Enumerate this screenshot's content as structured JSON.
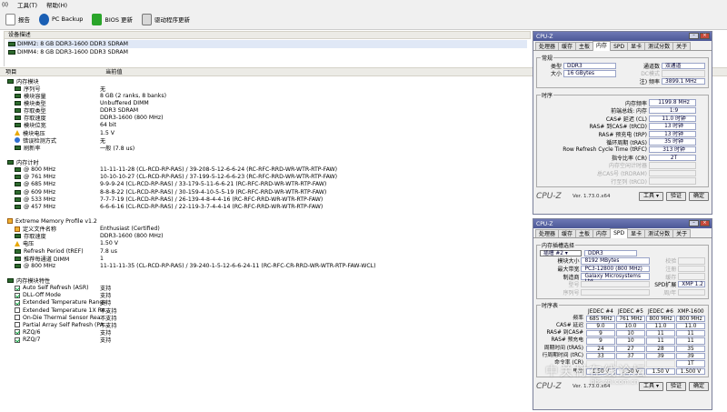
{
  "menu": [
    "(I)",
    "工具(T)",
    "帮助(H)"
  ],
  "toolbar": {
    "report": "报告",
    "pc_backup": "PC Backup",
    "bios_update": "BIOS 更新",
    "driver_update": "驱动程序更新"
  },
  "device_header": "设备描述",
  "devices": [
    "DIMM2: 8 GB DDR3-1600 DDR3 SDRAM",
    "DIMM4: 8 GB DDR3-1600 DDR3 SDRAM"
  ],
  "columns": {
    "field": "项目",
    "value": "当前值"
  },
  "sections": [
    {
      "title": "内存模块",
      "rows": [
        {
          "f": "序列号",
          "v": "无",
          "ic": "sq"
        },
        {
          "f": "模块容量",
          "v": "8 GB (2 ranks, 8 banks)",
          "ic": "sq"
        },
        {
          "f": "模块类型",
          "v": "Unbuffered DIMM",
          "ic": "sq"
        },
        {
          "f": "存取类型",
          "v": "DDR3 SDRAM",
          "ic": "sq"
        },
        {
          "f": "存取速度",
          "v": "DDR3-1600 (800 MHz)",
          "ic": "sq"
        },
        {
          "f": "模块位宽",
          "v": "64 bit",
          "ic": "sq"
        },
        {
          "f": "模块电压",
          "v": "1.5 V",
          "ic": "warn"
        },
        {
          "f": "错误检测方式",
          "v": "无",
          "ic": "info"
        },
        {
          "f": "刷新率",
          "v": "一般 (7.8 us)",
          "ic": "sq"
        }
      ]
    },
    {
      "title": "内存计时",
      "rows": [
        {
          "f": "@ 800 MHz",
          "v": "11-11-11-28  (CL-RCD-RP-RAS) / 39-208-5-12-6-6-24  (RC-RFC-RRD-WR-WTR-RTP-FAW)",
          "ic": "sq"
        },
        {
          "f": "@ 761 MHz",
          "v": "10-10-10-27  (CL-RCD-RP-RAS) / 37-199-5-12-6-6-23  (RC-RFC-RRD-WR-WTR-RTP-FAW)",
          "ic": "sq"
        },
        {
          "f": "@ 685 MHz",
          "v": "9-9-9-24  (CL-RCD-RP-RAS) / 33-179-5-11-6-6-21  (RC-RFC-RRD-WR-WTR-RTP-FAW)",
          "ic": "sq"
        },
        {
          "f": "@ 609 MHz",
          "v": "8-8-8-22  (CL-RCD-RP-RAS) / 30-159-4-10-5-5-19  (RC-RFC-RRD-WR-WTR-RTP-FAW)",
          "ic": "sq"
        },
        {
          "f": "@ 533 MHz",
          "v": "7-7-7-19  (CL-RCD-RP-RAS) / 26-139-4-8-4-4-16  (RC-RFC-RRD-WR-WTR-RTP-FAW)",
          "ic": "sq"
        },
        {
          "f": "@ 457 MHz",
          "v": "6-6-6-16  (CL-RCD-RP-RAS) / 22-119-3-7-4-4-14  (RC-RFC-RRD-WR-WTR-RTP-FAW)",
          "ic": "sq"
        }
      ]
    },
    {
      "title": "Extreme Memory Profile v1.2",
      "title_ic": "xmp",
      "rows": [
        {
          "f": "定义文件名称",
          "v": "Enthusiast (Certified)",
          "ic": "xmp"
        },
        {
          "f": "存取速度",
          "v": "DDR3-1600 (800 MHz)",
          "ic": "sq"
        },
        {
          "f": "电压",
          "v": "1.50 V",
          "ic": "warn"
        },
        {
          "f": "Refresh Period (tREF)",
          "v": "7.8 us",
          "ic": "sq"
        },
        {
          "f": "推荐每通道 DIMM",
          "v": "1",
          "ic": "sq"
        },
        {
          "f": "@ 800 MHz",
          "v": "11-11-11-35  (CL-RCD-RP-RAS) / 39-240-1-5-12-6-6-24-11  (RC-RFC-CR-RRD-WR-WTR-RTP-FAW-WCL)",
          "ic": "sq"
        }
      ]
    },
    {
      "title": "内存模块特性",
      "rows": [
        {
          "f": "Auto Self Refresh (ASR)",
          "v": "支持",
          "ic": "chk on"
        },
        {
          "f": "DLL-Off Mode",
          "v": "支持",
          "ic": "chk on"
        },
        {
          "f": "Extended Temperature Range",
          "v": "支持",
          "ic": "chk on"
        },
        {
          "f": "Extended Temperature 1X Re...",
          "v": "不支持",
          "ic": "chk"
        },
        {
          "f": "On-Die Thermal Sensor Rea...",
          "v": "不支持",
          "ic": "chk"
        },
        {
          "f": "Partial Array Self Refresh (PA...",
          "v": "不支持",
          "ic": "chk"
        },
        {
          "f": "RZQ/6",
          "v": "支持",
          "ic": "chk on"
        },
        {
          "f": "RZQ/7",
          "v": "支持",
          "ic": "chk on"
        }
      ]
    }
  ],
  "cpuz1": {
    "title": "CPU-Z",
    "tabs": [
      "处理器",
      "缓存",
      "主板",
      "内存",
      "SPD",
      "显卡",
      "测试分数",
      "关于"
    ],
    "active_tab": 3,
    "general_title": "常规",
    "type_label": "类型",
    "type": "DDR3",
    "size_label": "大小",
    "size": "16 GBytes",
    "channels_label": "通道数",
    "channels": "双通道",
    "dc_label": "DC模式",
    "nb_label": "注) 频率",
    "nb": "3899.1 MHz",
    "timing_title": "时序",
    "timings": [
      {
        "l": "内存频率",
        "v": "1199.8 MHz"
      },
      {
        "l": "前端总线: 内存",
        "v": "1:9"
      },
      {
        "l": "CAS# 延迟 (CL)",
        "v": "11.0 时钟"
      },
      {
        "l": "RAS# 到CAS# (tRCD)",
        "v": "13 时钟"
      },
      {
        "l": "RAS# 预充电 (tRP)",
        "v": "13 时钟"
      },
      {
        "l": "循环周期 (tRAS)",
        "v": "35 时钟"
      },
      {
        "l": "Row Refresh Cycle Time (tRFC)",
        "v": "313 时钟"
      },
      {
        "l": "指令比率 (CR)",
        "v": "2T"
      },
      {
        "l": "内存空闲计时器",
        "v": ""
      },
      {
        "l": "总CAS号 (tRDRAM)",
        "v": ""
      },
      {
        "l": "行至列 (tRCD)",
        "v": ""
      }
    ],
    "logo": "CPU-Z",
    "version": "Ver. 1.73.0.x64",
    "tools": "工具",
    "validate": "验证",
    "ok": "确定"
  },
  "cpuz2": {
    "title": "CPU-Z",
    "tabs": [
      "处理器",
      "缓存",
      "主板",
      "内存",
      "SPD",
      "显卡",
      "测试分数",
      "关于"
    ],
    "active_tab": 4,
    "slot_title": "内存插槽选择",
    "slot": "插槽 #2",
    "slot_type": "DDR3",
    "fields": [
      {
        "l": "模块大小",
        "v": "8192 MBytes",
        "l2": "校验",
        "v2": ""
      },
      {
        "l": "最大带宽",
        "v": "PC3-12800 (800 MHz)",
        "l2": "注册",
        "v2": ""
      },
      {
        "l": "制造商",
        "v": "Galaxy Microsystems Ltd.",
        "l2": "缓存",
        "v2": ""
      },
      {
        "l": "型号",
        "v": "",
        "l2": "SPD扩展",
        "v2": "XMP 1.2"
      },
      {
        "l": "序列号",
        "v": "",
        "l2": "周/年",
        "v2": ""
      }
    ],
    "timing_title": "时序表",
    "table_headers": [
      "JEDEC #4",
      "JEDEC #5",
      "JEDEC #6",
      "XMP-1600"
    ],
    "table_rows": [
      {
        "l": "频率",
        "v": [
          "685 MHz",
          "761 MHz",
          "800 MHz",
          "800 MHz"
        ]
      },
      {
        "l": "CAS# 延迟",
        "v": [
          "9.0",
          "10.0",
          "11.0",
          "11.0"
        ]
      },
      {
        "l": "RAS# 到CAS#",
        "v": [
          "9",
          "10",
          "11",
          "11"
        ]
      },
      {
        "l": "RAS# 预充电",
        "v": [
          "9",
          "10",
          "11",
          "11"
        ]
      },
      {
        "l": "周期时间 (tRAS)",
        "v": [
          "24",
          "27",
          "28",
          "35"
        ]
      },
      {
        "l": "行周期时间 (tRC)",
        "v": [
          "33",
          "37",
          "39",
          "39"
        ]
      },
      {
        "l": "命令率 (CR)",
        "v": [
          "",
          "",
          "",
          "1T"
        ]
      },
      {
        "l": "电压",
        "v": [
          "1.50 V",
          "1.50 V",
          "1.50 V",
          "1.500 V"
        ]
      }
    ],
    "logo": "CPU-Z",
    "version": "Ver. 1.73.0.x64",
    "tools": "工具",
    "validate": "验证",
    "ok": "确定"
  },
  "watermark": {
    "main": "中关村在线论坛",
    "url": "bbs.zol.com.cn"
  }
}
